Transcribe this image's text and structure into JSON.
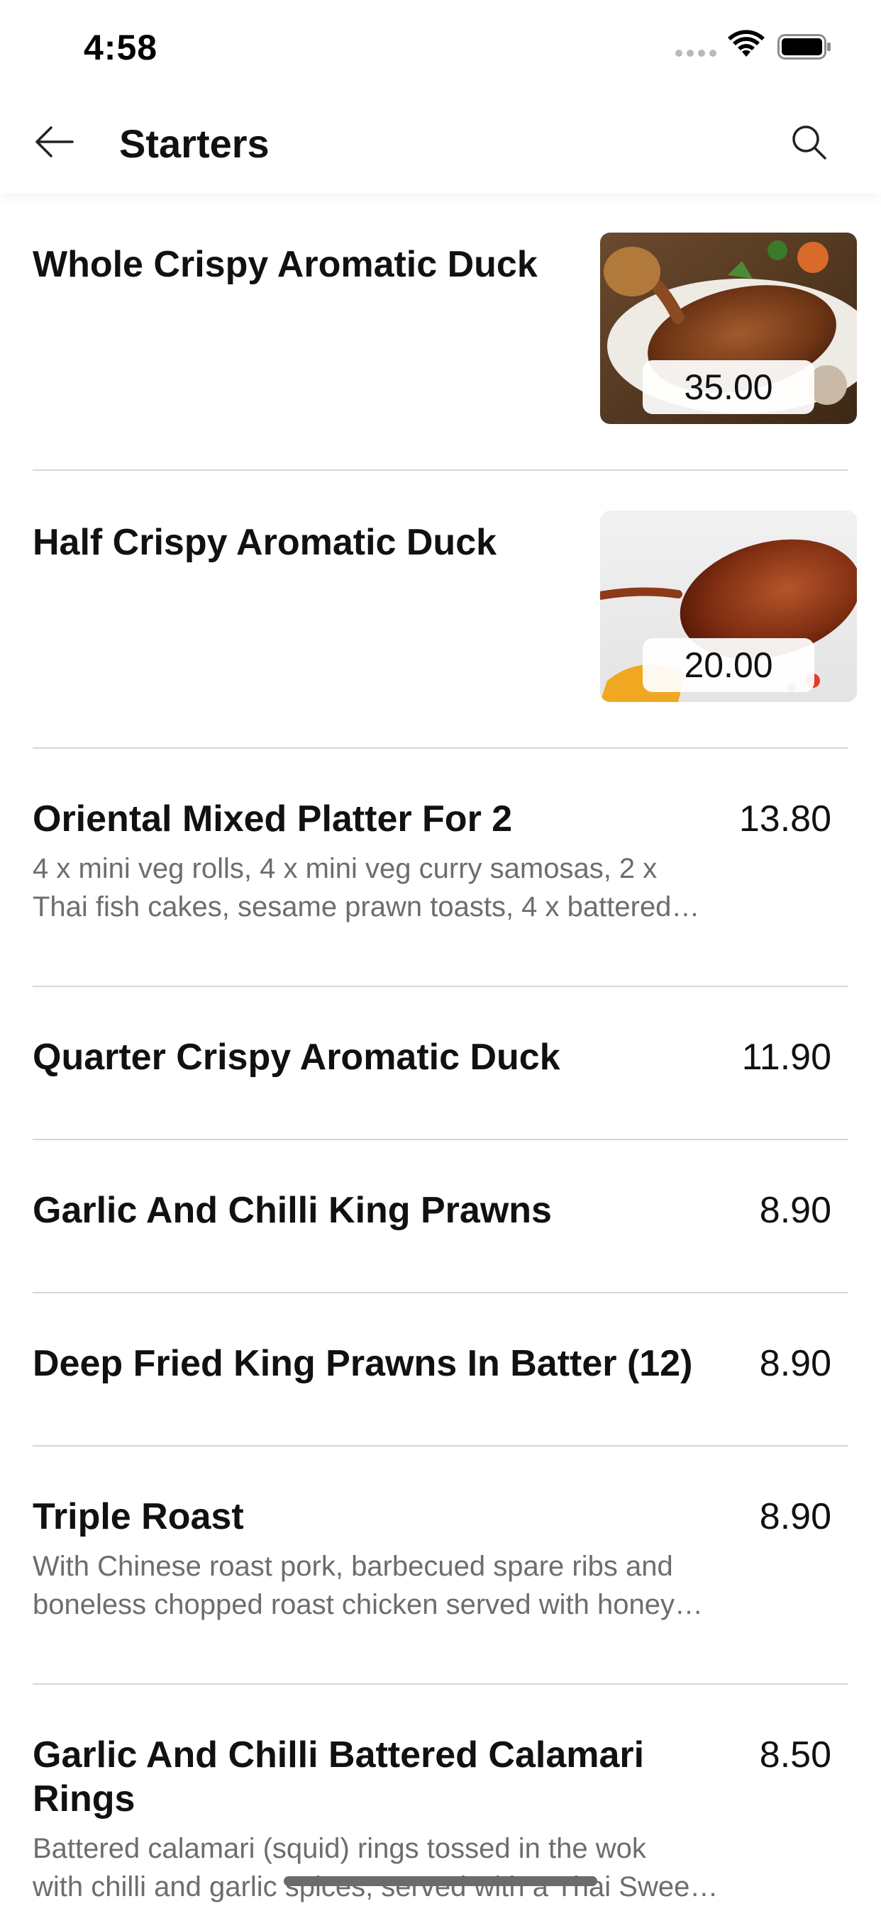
{
  "status_bar": {
    "time": "4:58"
  },
  "nav": {
    "title": "Starters",
    "back_icon": "arrow-left-icon",
    "search_icon": "search-icon"
  },
  "image_items": [
    {
      "name": "Whole Crispy Aromatic Duck",
      "price": "35.00"
    },
    {
      "name": "Half Crispy Aromatic Duck",
      "price": "20.00"
    }
  ],
  "items": [
    {
      "name": "Oriental Mixed Platter For 2",
      "price": "13.80",
      "desc_line1": "4 x mini veg rolls, 4 x mini veg curry samosas, 2 x",
      "desc_line2": "Thai fish cakes, sesame prawn toasts, 4 x battered…"
    },
    {
      "name": "Quarter Crispy Aromatic Duck",
      "price": "11.90"
    },
    {
      "name": "Garlic And Chilli King Prawns",
      "price": "8.90"
    },
    {
      "name": "Deep Fried King Prawns In Batter (12)",
      "price": "8.90"
    },
    {
      "name": "Triple Roast",
      "price": "8.90",
      "desc_line1": "With Chinese roast pork, barbecued spare ribs and",
      "desc_line2": "boneless chopped roast chicken served with honey…"
    },
    {
      "name": "Garlic And Chilli Battered Calamari Rings",
      "price": "8.50",
      "desc_line1": "Battered calamari (squid) rings tossed in the wok",
      "desc_line2": "with chilli and garlic spices, served with a Thai Swee…"
    }
  ]
}
